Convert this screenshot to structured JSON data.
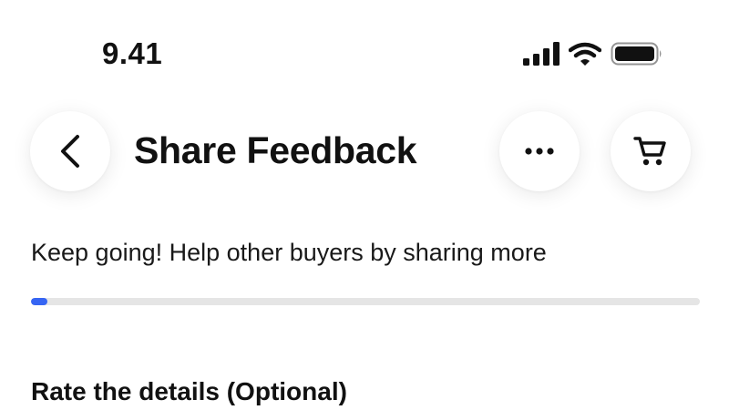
{
  "status_bar": {
    "time": "9.41",
    "icons": [
      "cellular-signal-icon",
      "wifi-icon",
      "battery-icon"
    ]
  },
  "header": {
    "title": "Share Feedback",
    "icons": [
      "chevron-left-icon",
      "more-horizontal-icon",
      "shopping-cart-icon"
    ]
  },
  "progress": {
    "label": "Keep going! Help other buyers by sharing more",
    "fraction": 0.025,
    "color": "#3665f3"
  },
  "section": {
    "title": "Rate the details (Optional)"
  }
}
